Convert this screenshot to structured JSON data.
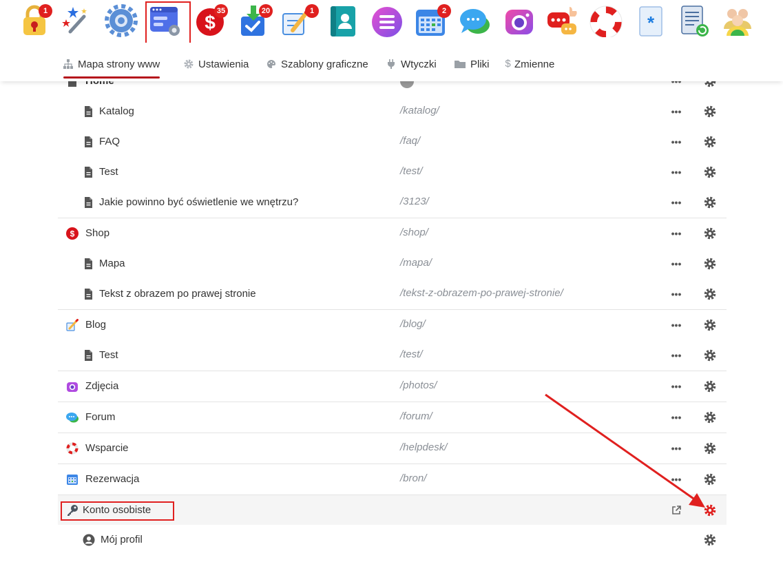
{
  "appbar": {
    "apps": [
      {
        "name": "lock-app-icon",
        "badge": "1"
      },
      {
        "name": "magic-wand-app-icon",
        "badge": ""
      },
      {
        "name": "settings-gear-app-icon",
        "badge": ""
      },
      {
        "name": "website-builder-app-icon",
        "badge": ""
      },
      {
        "name": "shop-dollar-app-icon",
        "badge": "35"
      },
      {
        "name": "download-tasks-app-icon",
        "badge": "20"
      },
      {
        "name": "blog-edit-app-icon",
        "badge": "1"
      },
      {
        "name": "contacts-app-icon",
        "badge": ""
      },
      {
        "name": "menu-list-app-icon",
        "badge": ""
      },
      {
        "name": "calendar-app-icon",
        "badge": "2"
      },
      {
        "name": "chat-app-icon",
        "badge": ""
      },
      {
        "name": "camera-app-icon",
        "badge": ""
      },
      {
        "name": "forum-app-icon",
        "badge": ""
      },
      {
        "name": "lifebuoy-app-icon",
        "badge": ""
      },
      {
        "name": "asterisk-doc-app-icon",
        "badge": ""
      },
      {
        "name": "document-sync-app-icon",
        "badge": ""
      },
      {
        "name": "users-app-icon",
        "badge": ""
      }
    ]
  },
  "tabs": [
    {
      "label": "Mapa strony www",
      "icon": "sitemap-icon"
    },
    {
      "label": "Ustawienia",
      "icon": "gear-icon"
    },
    {
      "label": "Szablony graficzne",
      "icon": "palette-icon"
    },
    {
      "label": "Wtyczki",
      "icon": "plug-icon"
    },
    {
      "label": "Pliki",
      "icon": "folder-icon"
    },
    {
      "label": "Zmienne",
      "icon": "dollar-icon"
    }
  ],
  "rows": [
    {
      "name": "Home",
      "url": ""
    },
    {
      "name": "Katalog",
      "url": "/katalog/"
    },
    {
      "name": "FAQ",
      "url": "/faq/"
    },
    {
      "name": "Test",
      "url": "/test/"
    },
    {
      "name": "Jakie powinno być oświetlenie we wnętrzu?",
      "url": "/3123/"
    },
    {
      "name": "Shop",
      "url": "/shop/"
    },
    {
      "name": "Mapa",
      "url": "/mapa/"
    },
    {
      "name": "Tekst z obrazem po prawej stronie",
      "url": "/tekst-z-obrazem-po-prawej-stronie/"
    },
    {
      "name": "Blog",
      "url": "/blog/"
    },
    {
      "name": "Test",
      "url": "/test/"
    },
    {
      "name": "Zdjęcia",
      "url": "/photos/"
    },
    {
      "name": "Forum",
      "url": "/forum/"
    },
    {
      "name": "Wsparcie",
      "url": "/helpdesk/"
    },
    {
      "name": "Rezerwacja",
      "url": "/bron/"
    },
    {
      "name": "Konto osobiste",
      "url": ""
    },
    {
      "name": "Mój profil",
      "url": ""
    }
  ],
  "more_label": "•••",
  "colors": {
    "accent_red": "#e0201f",
    "tab_underline": "#b5121b",
    "url_gray": "#8a8f96",
    "icon_gray": "#555555"
  }
}
